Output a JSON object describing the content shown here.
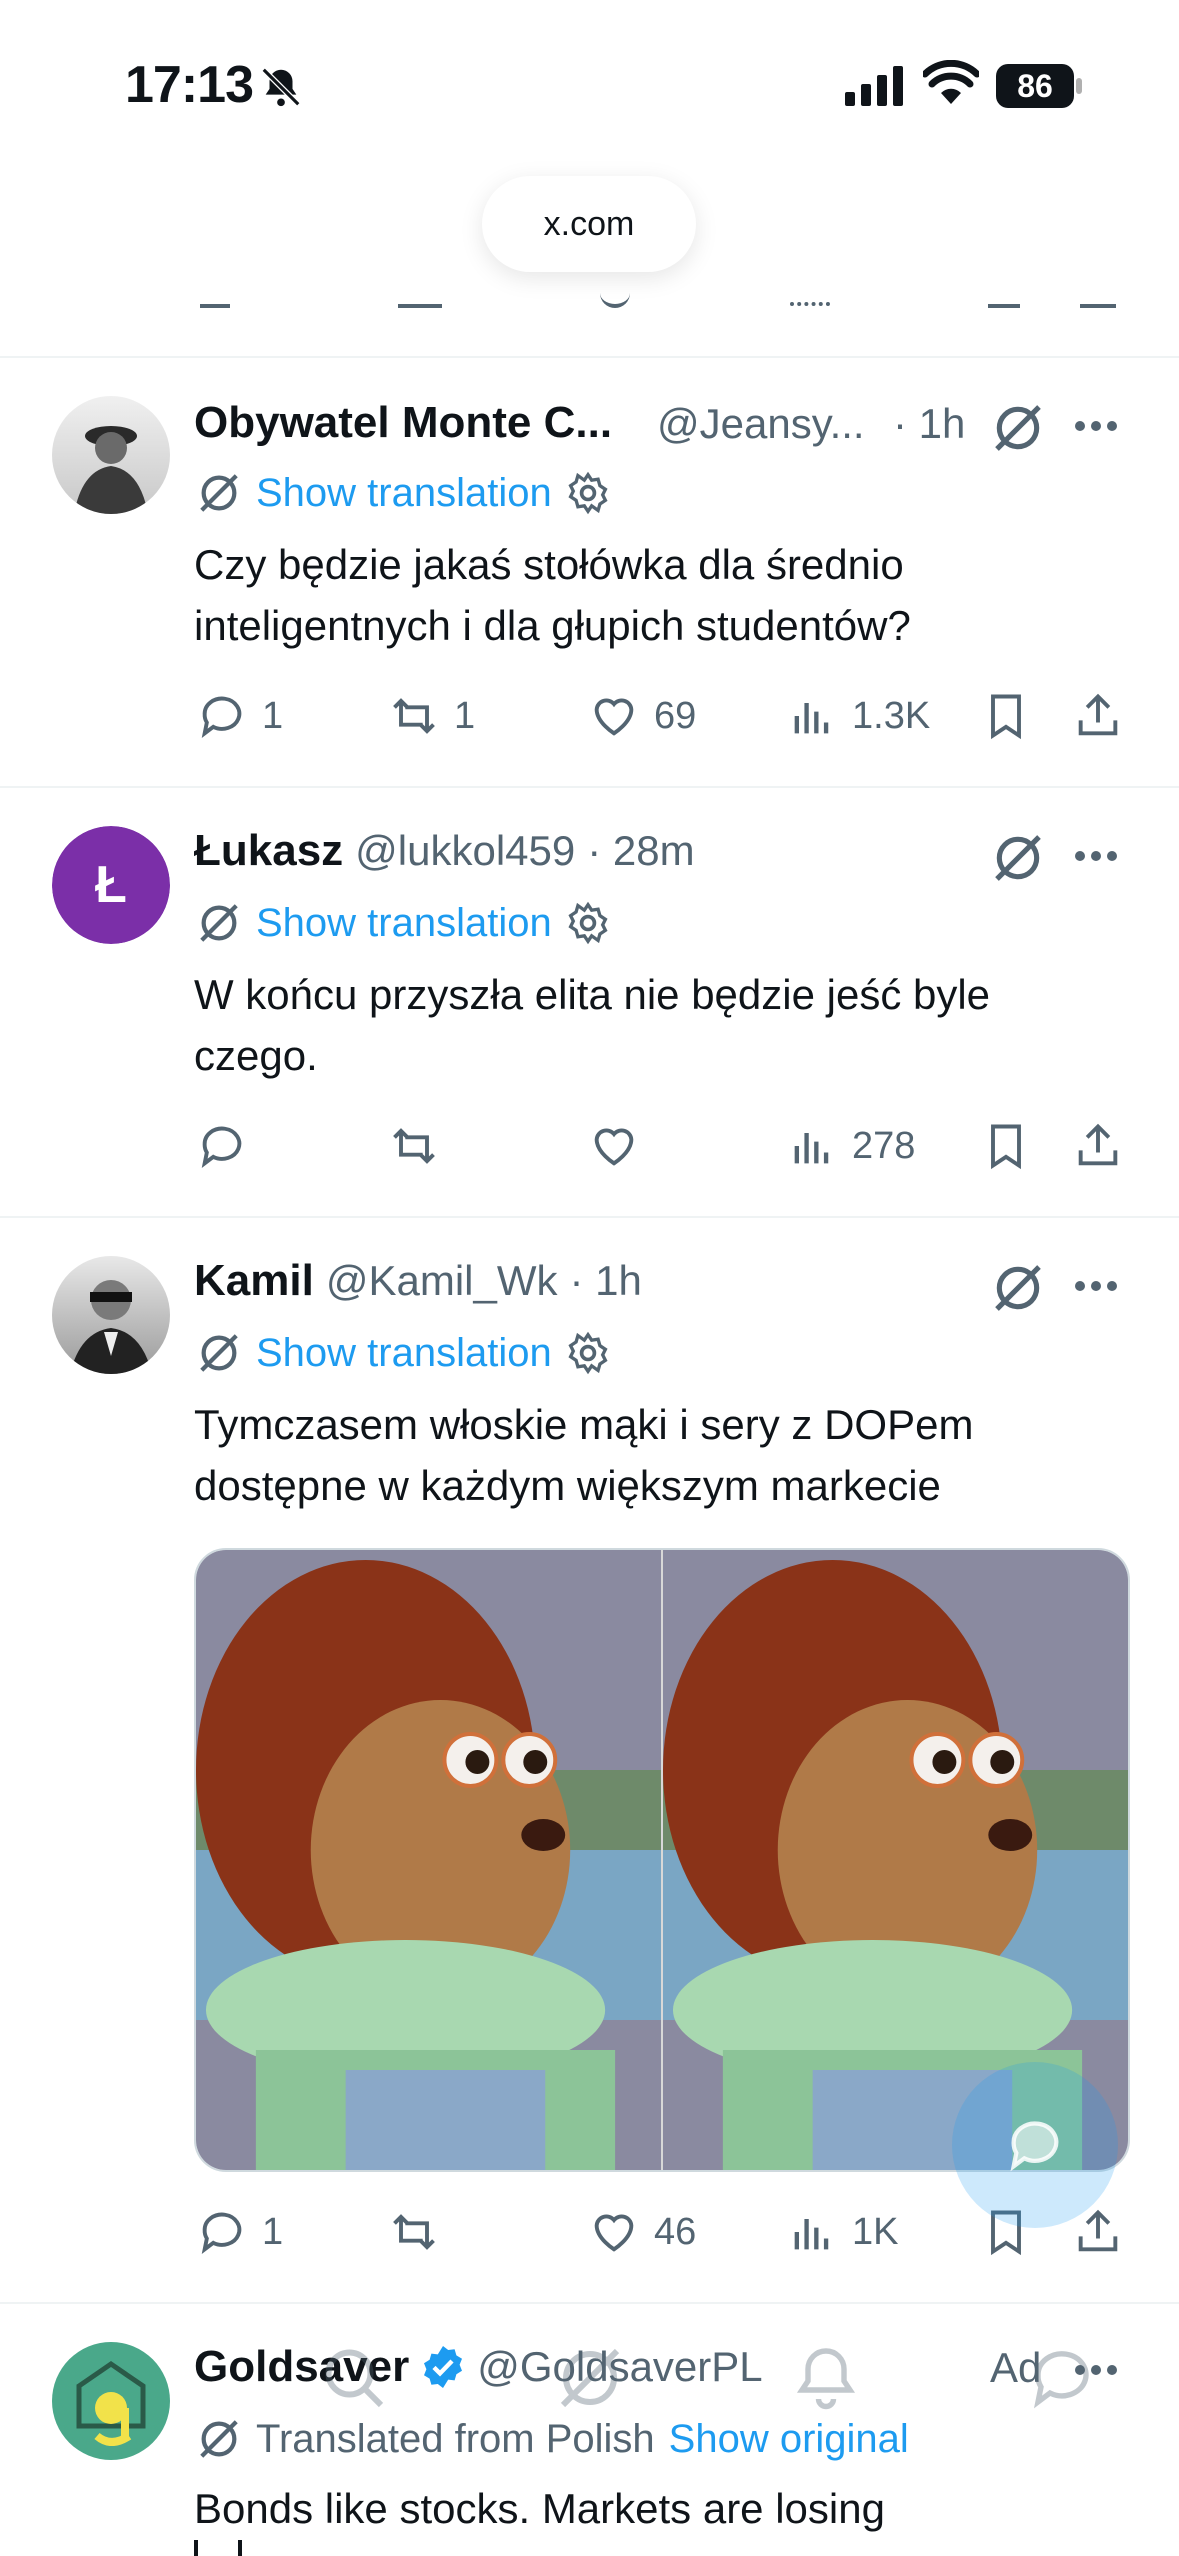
{
  "status_bar": {
    "time": "17:13",
    "battery": "86"
  },
  "browser": {
    "url": "x.com"
  },
  "tweets": [
    {
      "name": "Obywatel Monte C...",
      "handle": "@Jeansy...",
      "time": "· 1h",
      "translation_label": "Show translation",
      "text": "Czy będzie jakaś stołówka dla średnio inteligentnych i dla głupich studentów?",
      "replies": "1",
      "retweets": "1",
      "likes": "69",
      "views": "1.3K"
    },
    {
      "name": "Łukasz",
      "handle": "@lukkol459",
      "time": "· 28m",
      "avatar_letter": "Ł",
      "avatar_color": "#7b2fa8",
      "translation_label": "Show translation",
      "text": "W końcu przyszła elita nie będzie jeść byle czego.",
      "replies": "",
      "retweets": "",
      "likes": "",
      "views": "278"
    },
    {
      "name": "Kamil",
      "handle": "@Kamil_Wk",
      "time": "· 1h",
      "translation_label": "Show translation",
      "text": "Tymczasem włoskie mąki i sery z DOPem dostępne w każdym większym markecie",
      "replies": "1",
      "retweets": "",
      "likes": "46",
      "views": "1K"
    },
    {
      "name": "Goldsaver",
      "handle": "@GoldsaverPL",
      "ad_label": "Ad",
      "translated_from": "Translated from Polish",
      "show_original": "Show original",
      "text": "Bonds like stocks. Markets are losing"
    }
  ],
  "colors": {
    "accent": "#1d9bf0",
    "muted": "#536471",
    "text": "#0f1419",
    "divider": "#eff3f4"
  }
}
